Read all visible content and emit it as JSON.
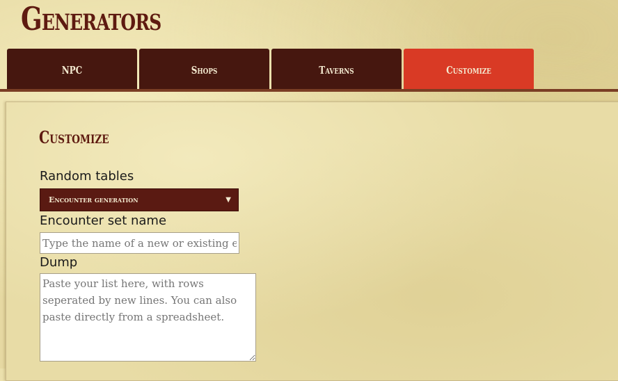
{
  "page": {
    "title": "Generators"
  },
  "tabs": [
    {
      "label": "NPC",
      "active": false
    },
    {
      "label": "Shops",
      "active": false
    },
    {
      "label": "Taverns",
      "active": false
    },
    {
      "label": "Customize",
      "active": true
    }
  ],
  "section": {
    "title": "Customize"
  },
  "form": {
    "random_tables_label": "Random tables",
    "random_tables_value": "Encounter generation",
    "encounter_set_label": "Encounter set name",
    "encounter_set_placeholder": "Type the name of a new or existing encounter set",
    "dump_label": "Dump",
    "dump_placeholder": "Paste your list here, with rows seperated by new lines. You can also paste directly from a spreadsheet."
  },
  "colors": {
    "tab_bg": "#46170f",
    "tab_active_bg": "#d93a25",
    "title_color": "#5e1a10",
    "parchment": "#e6d9a2"
  },
  "icons": {
    "select_arrow": "triangle-down-icon"
  }
}
